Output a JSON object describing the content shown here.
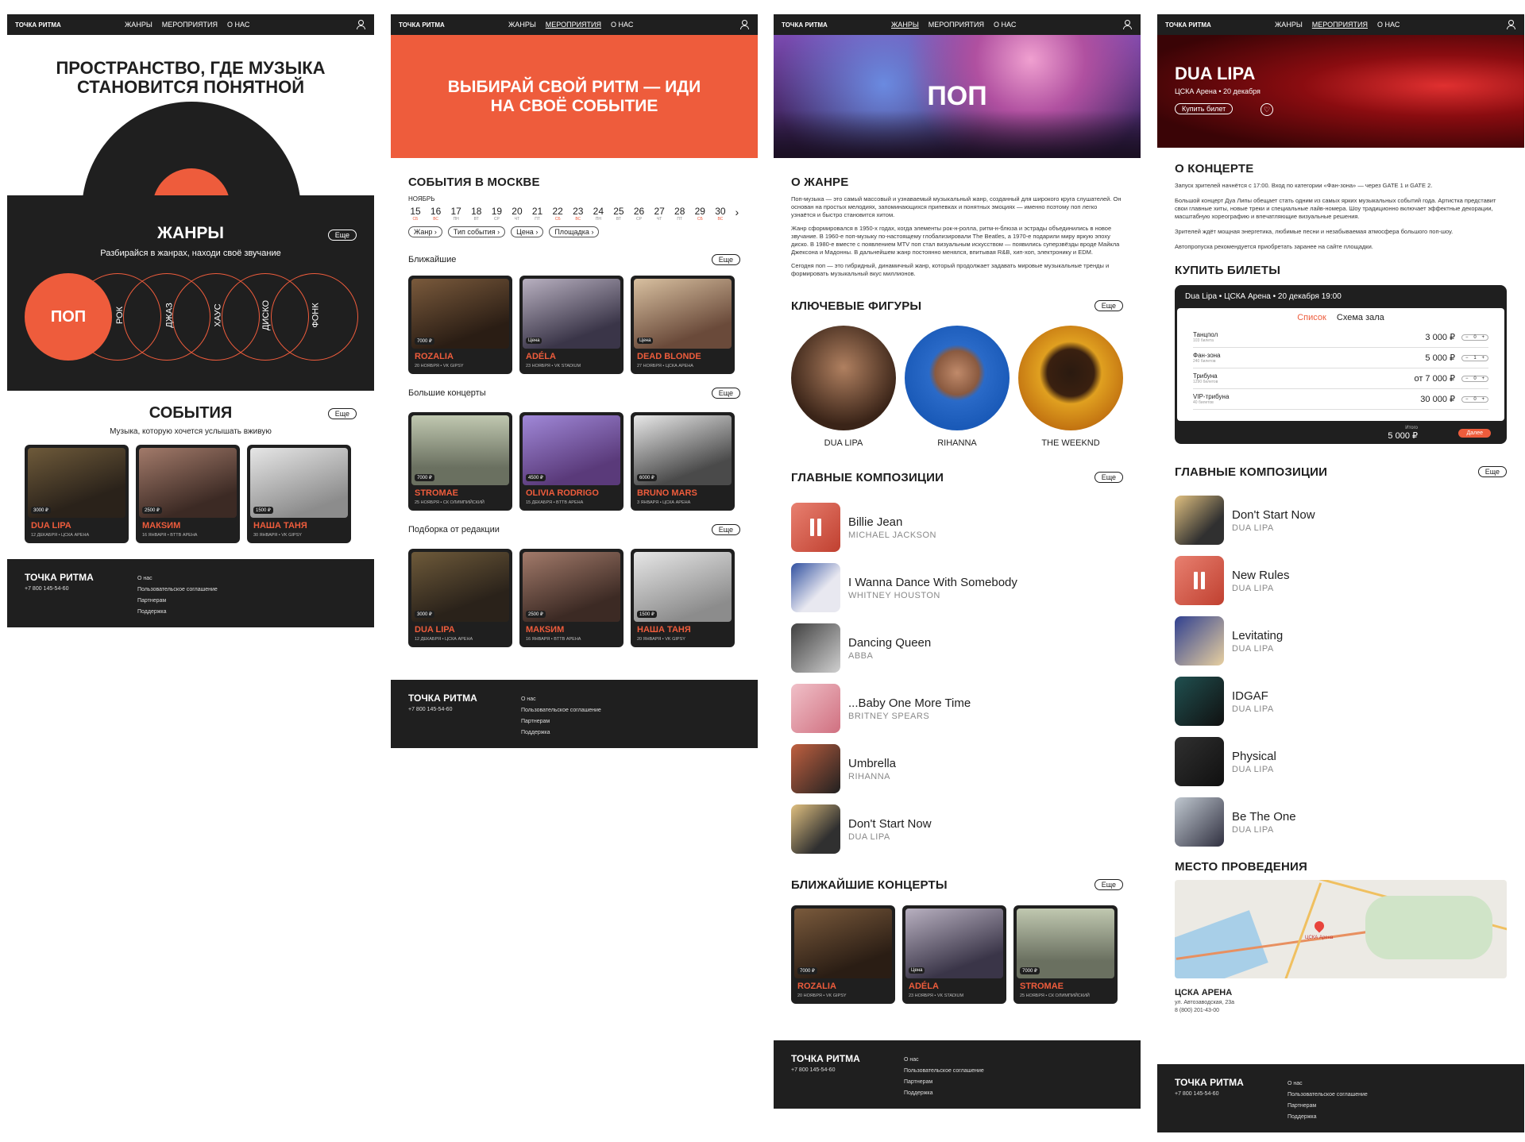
{
  "nav": {
    "logo": "ТОЧКА РИТМА",
    "genres": "ЖАНРЫ",
    "events": "МЕРОПРИЯТИЯ",
    "about": "О НАС"
  },
  "footer": {
    "logo": "ТОЧКА РИТМА",
    "phone": "+7 800 145-54-60",
    "links": [
      "О нас",
      "Пользовательское соглашение",
      "Партнерам",
      "Поддержка"
    ]
  },
  "more": "Еще",
  "home": {
    "hero": "ПРОСТРАНСТВО, ГДЕ МУЗЫКА СТАНОВИТСЯ ПОНЯТНОЙ",
    "genres_title": "ЖАНРЫ",
    "genres_sub": "Разбирайся в жанрах, находи своё звучание",
    "genre_list": [
      "ПОП",
      "РОК",
      "ДЖАЗ",
      "ХАУС",
      "ДИСКО",
      "ФОНК"
    ],
    "events_title": "СОБЫТИЯ",
    "events_sub": "Музыка, которую хочется услышать вживую"
  },
  "events_page": {
    "hero": "ВЫБИРАЙ СВОЙ РИТМ — ИДИ НА СВОЁ СОБЫТИЕ",
    "title": "СОБЫТИЯ В МОСКВЕ",
    "month": "НОЯБРЬ",
    "days": [
      [
        "15",
        "СБ"
      ],
      [
        "16",
        "ВС"
      ],
      [
        "17",
        "ПН"
      ],
      [
        "18",
        "ВТ"
      ],
      [
        "19",
        "СР"
      ],
      [
        "20",
        "ЧТ"
      ],
      [
        "21",
        "ПТ"
      ],
      [
        "22",
        "СБ"
      ],
      [
        "23",
        "ВС"
      ],
      [
        "24",
        "ПН"
      ],
      [
        "25",
        "ВТ"
      ],
      [
        "26",
        "СР"
      ],
      [
        "27",
        "ЧТ"
      ],
      [
        "28",
        "ПТ"
      ],
      [
        "29",
        "СБ"
      ],
      [
        "30",
        "ВС"
      ]
    ],
    "filters": [
      "Жанр",
      "Тип события",
      "Цена",
      "Площадка"
    ],
    "nearest": "Ближайшие",
    "big": "Большие концерты",
    "editors": "Подборка от редакции"
  },
  "cards": {
    "dua": {
      "price": "3000 ₽",
      "name": "DUA LIPA",
      "meta": "12 ДЕКАБРЯ • ЦСКА АРЕНА"
    },
    "maksim": {
      "price": "2500 ₽",
      "name": "МАКSИМ",
      "meta": "16 ЯНВАРЯ • BTTB АРЕНА"
    },
    "tanya": {
      "price": "1500 ₽",
      "name": "НАША ТАНЯ",
      "meta": "30 ЯНВАРЯ • VK GIPSY"
    },
    "rozalia": {
      "price": "7000 ₽",
      "name": "ROZALIA",
      "meta": "20 НОЯБРЯ • VK GIPSY"
    },
    "adela": {
      "price": "Цена",
      "name": "ADÉLA",
      "meta": "23 НОЯБРЯ • VK STADIUM"
    },
    "dead": {
      "price": "Цена",
      "name": "DEAD BLONDE",
      "meta": "27 НОЯБРЯ • ЦСКА АРЕНА"
    },
    "stromae": {
      "price": "7000 ₽",
      "name": "STROMAE",
      "meta": "25 НОЯБРЯ • СК ОЛИМПИЙСКИЙ"
    },
    "olivia": {
      "price": "4500 ₽",
      "name": "OLIVIA RODRIGO",
      "meta": "15 ДЕКАБРЯ • BTTB АРЕНА"
    },
    "bruno": {
      "price": "6000 ₽",
      "name": "BRUNO MARS",
      "meta": "3 ЯНВАРЯ • ЦСКА АРЕНА"
    },
    "dua2": {
      "price": "3000 ₽",
      "name": "DUA LIPA",
      "meta": "12 ДЕКАБРЯ • ЦСКА АРЕНА"
    },
    "tanya2": {
      "price": "1500 ₽",
      "name": "НАША ТАНЯ",
      "meta": "20 ЯНВАРЯ • VK GIPSY"
    },
    "stromae2": {
      "price": "7000 ₽",
      "name": "STROMAE",
      "meta": "25 НОЯБРЯ • СК ОЛИМПИЙСКИЙ"
    }
  },
  "pop": {
    "hero": "ПОП",
    "about_title": "О ЖАНРЕ",
    "about": [
      "Поп-музыка — это самый массовый и узнаваемый музыкальный жанр, созданный для широкого круга слушателей. Он основан на простых мелодиях, запоминающихся припевках и понятных эмоциях — именно поэтому поп легко узнаётся и быстро становится хитом.",
      "Жанр сформировался в 1950-х годах, когда элементы рок-н-ролла, ритм-н-блюза и эстрады объединились в новое звучание. В 1960-е поп-музыку по-настоящему глобализировали The Beatles, а 1970-е подарили миру яркую эпоху диско. В 1980-е вместе с появлением MTV поп стал визуальным искусством — появились суперзвёзды вроде Майкла Джексона и Мадонны. В дальнейшем жанр постоянно менялся, впитывая R&B, хип-хоп, электронику и EDM.",
      "Сегодня поп — это гибридный, динамичный жанр, который продолжает задавать мировые музыкальные тренды и формировать музыкальный вкус миллионов."
    ],
    "figures_title": "КЛЮЧЕВЫЕ ФИГУРЫ",
    "figures": [
      "DUA LIPA",
      "RIHANNA",
      "THE WEEKND"
    ],
    "songs_title": "ГЛАВНЫЕ КОМПОЗИЦИИ",
    "songs": [
      [
        "Billie Jean",
        "MICHAEL JACKSON"
      ],
      [
        "I Wanna Dance With Somebody",
        "WHITNEY HOUSTON"
      ],
      [
        "Dancing Queen",
        "ABBA"
      ],
      [
        "...Baby One More Time",
        "BRITNEY SPEARS"
      ],
      [
        "Umbrella",
        "RIHANNA"
      ],
      [
        "Don't Start Now",
        "DUA LIPA"
      ]
    ],
    "concerts_title": "БЛИЖАЙШИЕ КОНЦЕРТЫ"
  },
  "concert": {
    "artist": "DUA LIPA",
    "sub": "ЦСКА Арена • 20 декабря",
    "buy": "Купить билет",
    "about_title": "О КОНЦЕРТЕ",
    "about": [
      "Запуск зрителей начнётся с 17:00. Вход по категории «Фан-зона» — через GATE 1 и GATE 2.",
      "Большой концерт Дуа Липы обещает стать одним из самых ярких музыкальных событий года. Артистка представит свои главные хиты, новые треки и специальные лайв-номера. Шоу традиционно включает эффектные декорации, масштабную хореографию и впечатляющие визуальные решения.",
      "Зрителей ждёт мощная энергетика, любимые песни и незабываемая атмосфера большого поп-шоу.",
      "Автопропуска рекомендуется приобретать заранее на сайте площадки."
    ],
    "tickets_title": "КУПИТЬ БИЛЕТЫ",
    "ticket_head": "Dua Lipa • ЦСКА Арена • 20 декабря 19:00",
    "tab_list": "Список",
    "tab_map": "Схема зала",
    "tickets": [
      [
        "Танцпол",
        "103 билета",
        "3 000 ₽",
        "0"
      ],
      [
        "Фан-зона",
        "240 билетов",
        "5 000 ₽",
        "1"
      ],
      [
        "Трибуна",
        "1290 билетов",
        "от 7 000 ₽",
        "0"
      ],
      [
        "VIP-трибуна",
        "40 билетов",
        "30 000 ₽",
        "0"
      ]
    ],
    "total_label": "Итого",
    "total": "5 000 ₽",
    "pay": "Далее",
    "songs_title": "ГЛАВНЫЕ КОМПОЗИЦИИ",
    "songs": [
      [
        "Don't Start Now",
        "DUA LIPA"
      ],
      [
        "New Rules",
        "DUA LIPA"
      ],
      [
        "Levitating",
        "DUA LIPA"
      ],
      [
        "IDGAF",
        "DUA LIPA"
      ],
      [
        "Physical",
        "DUA LIPA"
      ],
      [
        "Be The One",
        "DUA LIPA"
      ]
    ],
    "venue_title": "МЕСТО ПРОВЕДЕНИЯ",
    "venue": "ЦСКА АРЕНА",
    "address": "ул. Автозаводская, 23а",
    "phone": "8 (800) 201-43-00",
    "map_pin": "ЦСКА Арена"
  },
  "colors": {
    "accent": "#ee5c3c",
    "dark": "#1f1f1f"
  }
}
